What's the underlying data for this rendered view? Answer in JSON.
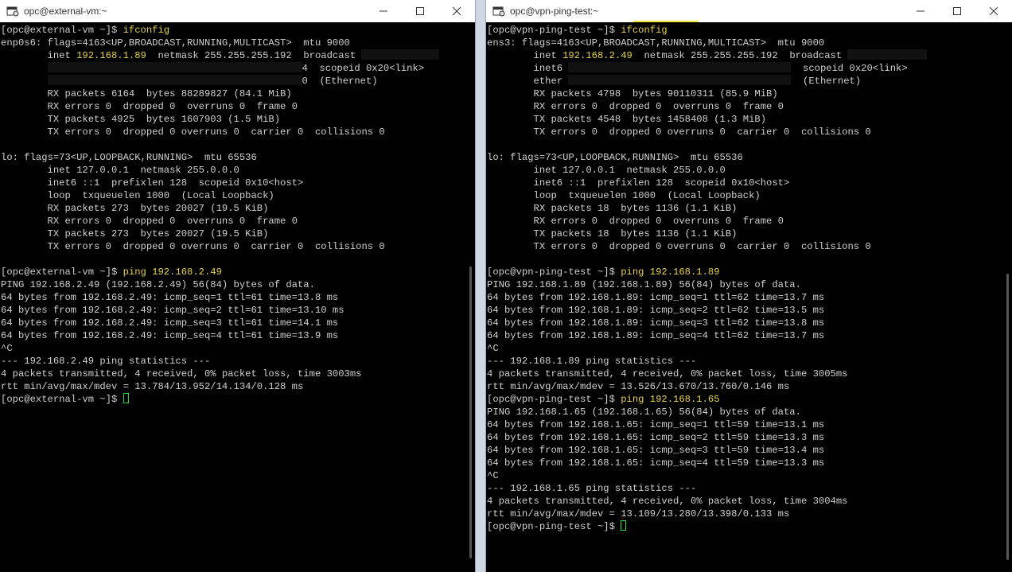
{
  "colors": {
    "terminal_bg": "#000000",
    "terminal_fg": "#d0d0d0",
    "highlight": "#e5d247",
    "cursor": "#22e022"
  },
  "left": {
    "title": "opc@external-vm:~",
    "lines": [
      {
        "parts": [
          {
            "t": "[opc@external-vm ~]$ "
          },
          {
            "t": "ifconfig",
            "c": "cmd"
          }
        ]
      },
      {
        "parts": [
          {
            "t": "enp0s6: flags=4163<UP,BROADCAST,RUNNING,MULTICAST>  mtu 9000"
          }
        ]
      },
      {
        "parts": [
          {
            "t": "        inet "
          },
          {
            "t": "192.168.1.89",
            "c": "ip"
          },
          {
            "t": "  netmask 255.255.255.192  broadcast "
          },
          {
            "r": 98
          }
        ]
      },
      {
        "parts": [
          {
            "t": "        "
          },
          {
            "r": 320
          },
          {
            "t": "4  scopeid 0x20<link>"
          }
        ]
      },
      {
        "parts": [
          {
            "t": "        "
          },
          {
            "r": 320
          },
          {
            "t": "0  (Ethernet)"
          }
        ]
      },
      {
        "parts": [
          {
            "t": "        RX packets 6164  bytes 88289827 (84.1 MiB)"
          }
        ]
      },
      {
        "parts": [
          {
            "t": "        RX errors 0  dropped 0  overruns 0  frame 0"
          }
        ]
      },
      {
        "parts": [
          {
            "t": "        TX packets 4925  bytes 1607903 (1.5 MiB)"
          }
        ]
      },
      {
        "parts": [
          {
            "t": "        TX errors 0  dropped 0 overruns 0  carrier 0  collisions 0"
          }
        ]
      },
      {
        "parts": [
          {
            "t": ""
          }
        ]
      },
      {
        "parts": [
          {
            "t": "lo: flags=73<UP,LOOPBACK,RUNNING>  mtu 65536"
          }
        ]
      },
      {
        "parts": [
          {
            "t": "        inet 127.0.0.1  netmask 255.0.0.0"
          }
        ]
      },
      {
        "parts": [
          {
            "t": "        inet6 ::1  prefixlen 128  scopeid 0x10<host>"
          }
        ]
      },
      {
        "parts": [
          {
            "t": "        loop  txqueuelen 1000  (Local Loopback)"
          }
        ]
      },
      {
        "parts": [
          {
            "t": "        RX packets 273  bytes 20027 (19.5 KiB)"
          }
        ]
      },
      {
        "parts": [
          {
            "t": "        RX errors 0  dropped 0  overruns 0  frame 0"
          }
        ]
      },
      {
        "parts": [
          {
            "t": "        TX packets 273  bytes 20027 (19.5 KiB)"
          }
        ]
      },
      {
        "parts": [
          {
            "t": "        TX errors 0  dropped 0 overruns 0  carrier 0  collisions 0"
          }
        ]
      },
      {
        "parts": [
          {
            "t": ""
          }
        ]
      },
      {
        "parts": [
          {
            "t": "[opc@external-vm ~]$ "
          },
          {
            "t": "ping 192.168.2.49",
            "c": "cmd"
          }
        ]
      },
      {
        "parts": [
          {
            "t": "PING 192.168.2.49 (192.168.2.49) 56(84) bytes of data."
          }
        ]
      },
      {
        "parts": [
          {
            "t": "64 bytes from 192.168.2.49: icmp_seq=1 ttl=61 time=13.8 ms"
          }
        ]
      },
      {
        "parts": [
          {
            "t": "64 bytes from 192.168.2.49: icmp_seq=2 ttl=61 time=13.10 ms"
          }
        ]
      },
      {
        "parts": [
          {
            "t": "64 bytes from 192.168.2.49: icmp_seq=3 ttl=61 time=14.1 ms"
          }
        ]
      },
      {
        "parts": [
          {
            "t": "64 bytes from 192.168.2.49: icmp_seq=4 ttl=61 time=13.9 ms"
          }
        ]
      },
      {
        "parts": [
          {
            "t": "^C"
          }
        ]
      },
      {
        "parts": [
          {
            "t": "--- 192.168.2.49 ping statistics ---"
          }
        ]
      },
      {
        "parts": [
          {
            "t": "4 packets transmitted, 4 received, 0% packet loss, time 3003ms"
          }
        ]
      },
      {
        "parts": [
          {
            "t": "rtt min/avg/max/mdev = 13.784/13.952/14.134/0.128 ms"
          }
        ]
      },
      {
        "parts": [
          {
            "t": "[opc@external-vm ~]$ "
          },
          {
            "cursor": true
          }
        ]
      }
    ]
  },
  "right": {
    "title": "opc@vpn-ping-test:~",
    "lines": [
      {
        "parts": [
          {
            "t": "[opc@vpn-ping-test ~]$ "
          },
          {
            "t": "ifconfig",
            "c": "cmd"
          }
        ]
      },
      {
        "parts": [
          {
            "t": "ens3: flags=4163<UP,BROADCAST,RUNNING,MULTICAST>  mtu 9000"
          }
        ]
      },
      {
        "parts": [
          {
            "t": "        inet "
          },
          {
            "t": "192.168.2.49",
            "c": "ip"
          },
          {
            "t": "  netmask 255.255.255.192  broadcast "
          },
          {
            "r": 100
          }
        ]
      },
      {
        "parts": [
          {
            "t": "        inet6 "
          },
          {
            "r": 280
          },
          {
            "t": "  scopeid 0x20<link>"
          }
        ]
      },
      {
        "parts": [
          {
            "t": "        ether "
          },
          {
            "r": 280
          },
          {
            "t": "  (Ethernet)"
          }
        ]
      },
      {
        "parts": [
          {
            "t": "        RX packets 4798  bytes 90110311 (85.9 MiB)"
          }
        ]
      },
      {
        "parts": [
          {
            "t": "        RX errors 0  dropped 0  overruns 0  frame 0"
          }
        ]
      },
      {
        "parts": [
          {
            "t": "        TX packets 4548  bytes 1458408 (1.3 MiB)"
          }
        ]
      },
      {
        "parts": [
          {
            "t": "        TX errors 0  dropped 0 overruns 0  carrier 0  collisions 0"
          }
        ]
      },
      {
        "parts": [
          {
            "t": ""
          }
        ]
      },
      {
        "parts": [
          {
            "t": "lo: flags=73<UP,LOOPBACK,RUNNING>  mtu 65536"
          }
        ]
      },
      {
        "parts": [
          {
            "t": "        inet 127.0.0.1  netmask 255.0.0.0"
          }
        ]
      },
      {
        "parts": [
          {
            "t": "        inet6 ::1  prefixlen 128  scopeid 0x10<host>"
          }
        ]
      },
      {
        "parts": [
          {
            "t": "        loop  txqueuelen 1000  (Local Loopback)"
          }
        ]
      },
      {
        "parts": [
          {
            "t": "        RX packets 18  bytes 1136 (1.1 KiB)"
          }
        ]
      },
      {
        "parts": [
          {
            "t": "        RX errors 0  dropped 0  overruns 0  frame 0"
          }
        ]
      },
      {
        "parts": [
          {
            "t": "        TX packets 18  bytes 1136 (1.1 KiB)"
          }
        ]
      },
      {
        "parts": [
          {
            "t": "        TX errors 0  dropped 0 overruns 0  carrier 0  collisions 0"
          }
        ]
      },
      {
        "parts": [
          {
            "t": ""
          }
        ]
      },
      {
        "parts": [
          {
            "t": "[opc@vpn-ping-test ~]$ "
          },
          {
            "t": "ping 192.168.1.89",
            "c": "cmd"
          }
        ]
      },
      {
        "parts": [
          {
            "t": "PING 192.168.1.89 (192.168.1.89) 56(84) bytes of data."
          }
        ]
      },
      {
        "parts": [
          {
            "t": "64 bytes from 192.168.1.89: icmp_seq=1 ttl=62 time=13.7 ms"
          }
        ]
      },
      {
        "parts": [
          {
            "t": "64 bytes from 192.168.1.89: icmp_seq=2 ttl=62 time=13.5 ms"
          }
        ]
      },
      {
        "parts": [
          {
            "t": "64 bytes from 192.168.1.89: icmp_seq=3 ttl=62 time=13.8 ms"
          }
        ]
      },
      {
        "parts": [
          {
            "t": "64 bytes from 192.168.1.89: icmp_seq=4 ttl=62 time=13.7 ms"
          }
        ]
      },
      {
        "parts": [
          {
            "t": "^C"
          }
        ]
      },
      {
        "parts": [
          {
            "t": "--- 192.168.1.89 ping statistics ---"
          }
        ]
      },
      {
        "parts": [
          {
            "t": "4 packets transmitted, 4 received, 0% packet loss, time 3005ms"
          }
        ]
      },
      {
        "parts": [
          {
            "t": "rtt min/avg/max/mdev = 13.526/13.670/13.760/0.146 ms"
          }
        ]
      },
      {
        "parts": [
          {
            "t": "[opc@vpn-ping-test ~]$ "
          },
          {
            "t": "ping 192.168.1.65",
            "c": "cmd"
          }
        ]
      },
      {
        "parts": [
          {
            "t": "PING 192.168.1.65 (192.168.1.65) 56(84) bytes of data."
          }
        ]
      },
      {
        "parts": [
          {
            "t": "64 bytes from 192.168.1.65: icmp_seq=1 ttl=59 time=13.1 ms"
          }
        ]
      },
      {
        "parts": [
          {
            "t": "64 bytes from 192.168.1.65: icmp_seq=2 ttl=59 time=13.3 ms"
          }
        ]
      },
      {
        "parts": [
          {
            "t": "64 bytes from 192.168.1.65: icmp_seq=3 ttl=59 time=13.4 ms"
          }
        ]
      },
      {
        "parts": [
          {
            "t": "64 bytes from 192.168.1.65: icmp_seq=4 ttl=59 time=13.3 ms"
          }
        ]
      },
      {
        "parts": [
          {
            "t": "^C"
          }
        ]
      },
      {
        "parts": [
          {
            "t": "--- 192.168.1.65 ping statistics ---"
          }
        ]
      },
      {
        "parts": [
          {
            "t": "4 packets transmitted, 4 received, 0% packet loss, time 3004ms"
          }
        ]
      },
      {
        "parts": [
          {
            "t": "rtt min/avg/max/mdev = 13.109/13.280/13.398/0.133 ms"
          }
        ]
      },
      {
        "parts": [
          {
            "t": "[opc@vpn-ping-test ~]$ "
          },
          {
            "cursor": true
          }
        ]
      }
    ]
  }
}
